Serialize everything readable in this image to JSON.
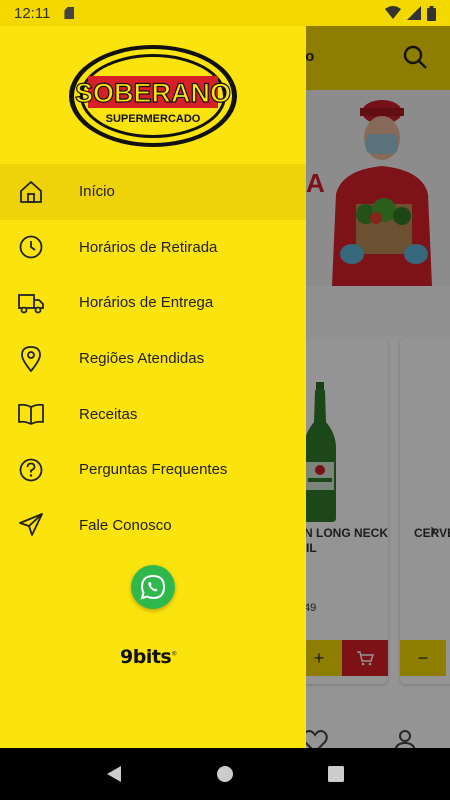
{
  "status_bar": {
    "time": "12:11"
  },
  "background_app": {
    "header_title_fragment": "no",
    "banner_letter": "A",
    "product_1": {
      "name_line1": "EN LONG NECK",
      "name_line2": "IL",
      "price_fragment": "49"
    },
    "product_2": {
      "name_line1": "CERVE"
    },
    "buttons": {
      "plus": "+",
      "minus": "−"
    },
    "chevron": "›"
  },
  "drawer": {
    "logo": {
      "brand": "SOBERANO",
      "subtitle": "SUPERMERCADO"
    },
    "menu": [
      {
        "label": "Início",
        "icon": "home-icon",
        "active": true
      },
      {
        "label": "Horários de Retirada",
        "icon": "clock-icon",
        "active": false
      },
      {
        "label": "Horários de Entrega",
        "icon": "truck-icon",
        "active": false
      },
      {
        "label": "Regiões Atendidas",
        "icon": "location-pin-icon",
        "active": false
      },
      {
        "label": "Receitas",
        "icon": "book-icon",
        "active": false
      },
      {
        "label": "Perguntas Frequentes",
        "icon": "question-icon",
        "active": false
      },
      {
        "label": "Fale Conosco",
        "icon": "send-icon",
        "active": false
      }
    ],
    "whatsapp_icon": "whatsapp-icon",
    "footer_brand": "9bits"
  },
  "colors": {
    "brand_yellow": "#fbe30e",
    "brand_red": "#d61f26",
    "whatsapp_green": "#2fb84b"
  }
}
